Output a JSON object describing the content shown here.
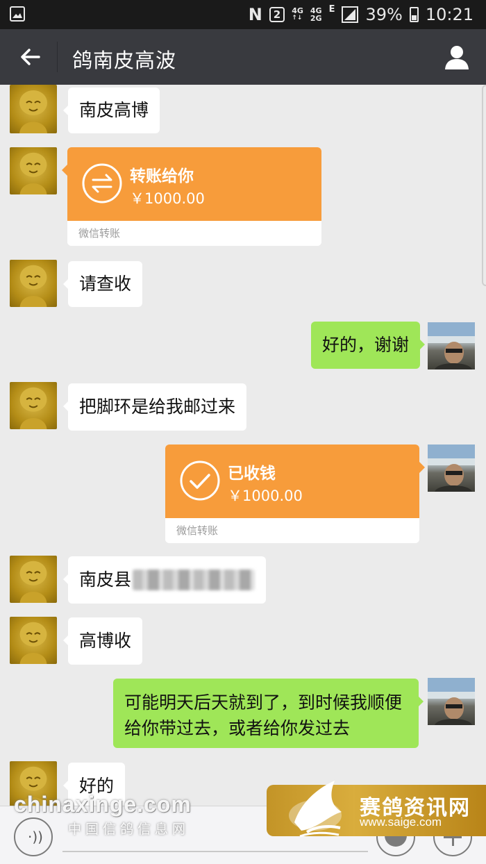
{
  "status_bar": {
    "nfc": "N",
    "sim": "2",
    "net1": "4G",
    "net2": "4G",
    "net3": "2G",
    "edge": "E",
    "battery": "39%",
    "time": "10:21"
  },
  "header": {
    "title": "鸽南皮高波"
  },
  "messages": [
    {
      "side": "left",
      "text": "南皮高博"
    },
    {
      "side": "left",
      "type": "transfer",
      "title": "转账给你",
      "amount": "￥1000.00",
      "footer": "微信转账"
    },
    {
      "side": "left",
      "text": "请查收"
    },
    {
      "side": "right",
      "text": "好的，谢谢"
    },
    {
      "side": "left",
      "text": "把脚环是给我邮过来"
    },
    {
      "side": "right",
      "type": "transfer",
      "title": "已收钱",
      "amount": "￥1000.00",
      "footer": "微信转账"
    },
    {
      "side": "left",
      "text": "南皮县"
    },
    {
      "side": "left",
      "text": "高博收"
    },
    {
      "side": "right",
      "text": "可能明天后天就到了，到时候我顺便给你带过去，或者给你发过去"
    },
    {
      "side": "left",
      "text": "好的"
    }
  ],
  "watermarks": {
    "left_en": "chinaxinge.com",
    "left_cn": "中国信鸽信息网",
    "right_cn": "赛鸽资讯网",
    "right_url": "www.saige.com"
  },
  "colors": {
    "header_bg": "#393a3f",
    "chat_bg": "#ebebeb",
    "my_bubble": "#9fe658",
    "transfer": "#f79c3b"
  }
}
